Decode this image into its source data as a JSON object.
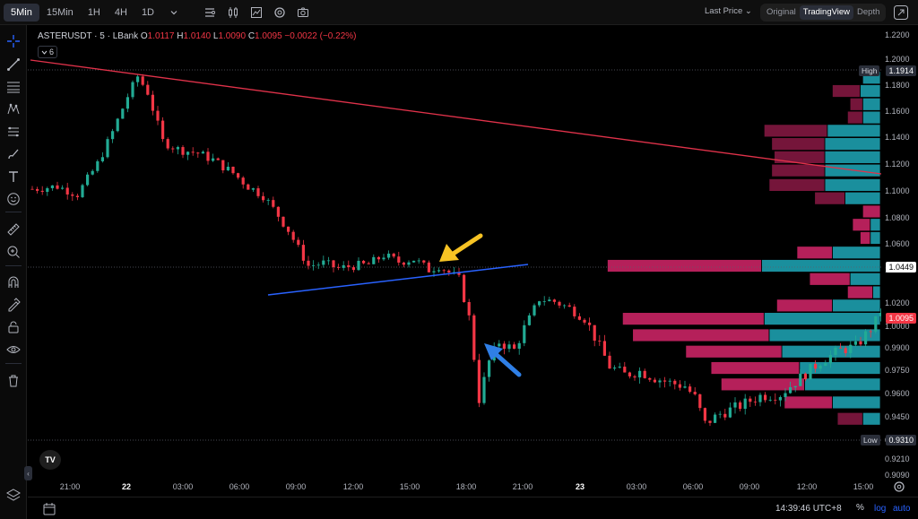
{
  "toolbar": {
    "timeframes": [
      "5Min",
      "15Min",
      "1H",
      "4H",
      "1D"
    ],
    "active_timeframe": "5Min",
    "last_price_label": "Last Price",
    "chart_modes": [
      "Original",
      "TradingView",
      "Depth"
    ],
    "active_mode": "TradingView"
  },
  "legend": {
    "symbol": "ASTERUSDT · 5 · LBank",
    "open_label": "O",
    "open": "1.0117",
    "high_label": "H",
    "high": "1.0140",
    "low_label": "L",
    "low": "1.0090",
    "close_label": "C",
    "close": "1.0095",
    "change": "−0.0022 (−0.22%)",
    "indicator_count": "6"
  },
  "price_axis": {
    "ticks": [
      "1.2200",
      "1.2000",
      "1.1800",
      "1.1600",
      "1.1400",
      "1.1200",
      "1.1000",
      "1.0800",
      "1.0600",
      "1.0400",
      "1.0200",
      "1.0000",
      "0.9900",
      "0.9750",
      "0.9600",
      "0.9450",
      "0.9310",
      "0.9210",
      "0.9090"
    ],
    "high_tag": "High",
    "high_value": "1.1914",
    "low_tag": "Low",
    "low_value": "0.9310",
    "crosshair_value": "1.0449",
    "current_value": "1.0095"
  },
  "time_axis": {
    "ticks": [
      "21:00",
      "22",
      "03:00",
      "06:00",
      "09:00",
      "12:00",
      "15:00",
      "18:00",
      "21:00",
      "23",
      "03:00",
      "06:00",
      "09:00",
      "12:00",
      "15:00"
    ]
  },
  "bottom": {
    "clock": "14:39:46 UTC+8",
    "percent_label": "%",
    "log_label": "log",
    "auto_label": "auto"
  },
  "colors": {
    "up": "#22ab94",
    "down": "#f23645",
    "trendline_red": "#e0324a",
    "trendline_blue": "#2962ff",
    "arrow_yellow": "#f7c324",
    "arrow_blue": "#2f7fe6",
    "vp_pink": "#d5266a",
    "vp_teal": "#1fa8b8"
  },
  "chart_data": {
    "type": "candlestick",
    "instrument": "ASTERUSDT",
    "interval": "5",
    "exchange": "LBank",
    "y_range": [
      0.905,
      1.225
    ],
    "overall_high": 1.1914,
    "overall_low": 0.931,
    "last": 1.0095,
    "path": [
      [
        0,
        1.103
      ],
      [
        5,
        1.105
      ],
      [
        9,
        1.099
      ],
      [
        13,
        1.122
      ],
      [
        16,
        1.146
      ],
      [
        19,
        1.173
      ],
      [
        21,
        1.188
      ],
      [
        23,
        1.176
      ],
      [
        26,
        1.139
      ],
      [
        29,
        1.133
      ],
      [
        33,
        1.13
      ],
      [
        36,
        1.125
      ],
      [
        40,
        1.115
      ],
      [
        43,
        1.105
      ],
      [
        46,
        1.098
      ],
      [
        49,
        1.083
      ],
      [
        51,
        1.072
      ],
      [
        53,
        1.058
      ],
      [
        55,
        1.045
      ],
      [
        58,
        1.047
      ],
      [
        61,
        1.043
      ],
      [
        64,
        1.045
      ],
      [
        67,
        1.046
      ],
      [
        70,
        1.053
      ],
      [
        73,
        1.048
      ],
      [
        76,
        1.05
      ],
      [
        79,
        1.042
      ],
      [
        81,
        1.045
      ],
      [
        83,
        1.04
      ],
      [
        85,
        1.035
      ],
      [
        87,
        1.006
      ],
      [
        89,
        0.955
      ],
      [
        91,
        0.978
      ],
      [
        93,
        0.99
      ],
      [
        96,
        0.985
      ],
      [
        99,
        1.005
      ],
      [
        101,
        1.02
      ],
      [
        104,
        1.018
      ],
      [
        107,
        1.013
      ],
      [
        110,
        1.005
      ],
      [
        112,
        0.993
      ],
      [
        115,
        0.975
      ],
      [
        118,
        0.97
      ],
      [
        121,
        0.972
      ],
      [
        124,
        0.968
      ],
      [
        127,
        0.965
      ],
      [
        130,
        0.963
      ],
      [
        132,
        0.956
      ],
      [
        134,
        0.94
      ],
      [
        137,
        0.946
      ],
      [
        141,
        0.951
      ],
      [
        145,
        0.957
      ],
      [
        149,
        0.958
      ],
      [
        153,
        0.968
      ],
      [
        157,
        0.978
      ],
      [
        161,
        0.985
      ],
      [
        164,
        0.987
      ],
      [
        167,
        0.998
      ],
      [
        169,
        1.0095
      ]
    ],
    "volume_profile": [
      {
        "price": 1.187,
        "buy": 0.07,
        "sell": 0.0
      },
      {
        "price": 1.177,
        "buy": 0.08,
        "sell": 0.11
      },
      {
        "price": 1.167,
        "buy": 0.07,
        "sell": 0.05
      },
      {
        "price": 1.157,
        "buy": 0.07,
        "sell": 0.06
      },
      {
        "price": 1.147,
        "buy": 0.21,
        "sell": 0.25
      },
      {
        "price": 1.137,
        "buy": 0.22,
        "sell": 0.21
      },
      {
        "price": 1.127,
        "buy": 0.22,
        "sell": 0.2
      },
      {
        "price": 1.117,
        "buy": 0.22,
        "sell": 0.21
      },
      {
        "price": 1.106,
        "buy": 0.22,
        "sell": 0.22
      },
      {
        "price": 1.096,
        "buy": 0.14,
        "sell": 0.12
      },
      {
        "price": 1.086,
        "buy": 0.0,
        "sell": 0.07
      },
      {
        "price": 1.076,
        "buy": 0.04,
        "sell": 0.07
      },
      {
        "price": 1.066,
        "buy": 0.04,
        "sell": 0.04
      },
      {
        "price": 1.055,
        "buy": 0.19,
        "sell": 0.14
      },
      {
        "price": 1.045,
        "buy": 0.47,
        "sell": 0.61
      },
      {
        "price": 1.035,
        "buy": 0.12,
        "sell": 0.16
      },
      {
        "price": 1.025,
        "buy": 0.03,
        "sell": 0.1
      },
      {
        "price": 1.015,
        "buy": 0.19,
        "sell": 0.22
      },
      {
        "price": 1.005,
        "buy": 0.46,
        "sell": 0.56
      },
      {
        "price": 0.994,
        "buy": 0.44,
        "sell": 0.54
      },
      {
        "price": 0.984,
        "buy": 0.39,
        "sell": 0.38
      },
      {
        "price": 0.974,
        "buy": 0.32,
        "sell": 0.35
      },
      {
        "price": 0.964,
        "buy": 0.3,
        "sell": 0.33
      },
      {
        "price": 0.953,
        "buy": 0.19,
        "sell": 0.19
      },
      {
        "price": 0.943,
        "buy": 0.07,
        "sell": 0.1
      }
    ]
  }
}
